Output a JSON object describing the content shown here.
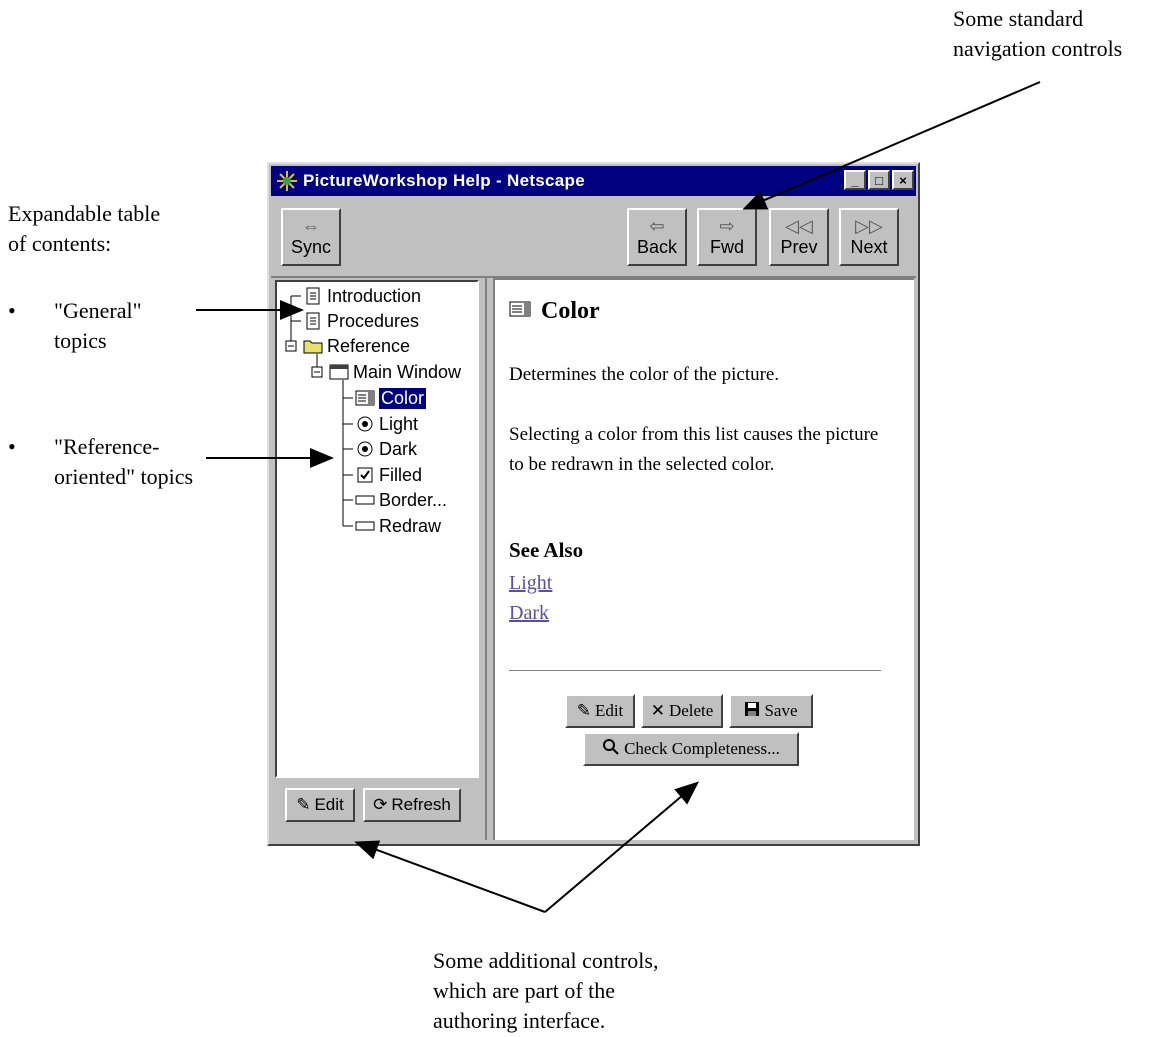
{
  "annotations": {
    "top_right": [
      "Some standard",
      "navigation controls"
    ],
    "left_heading": [
      "Expandable table",
      "of contents:"
    ],
    "general_bullet": [
      "\"General\"",
      "topics"
    ],
    "reference_bullet": [
      "\"Reference-",
      "oriented\" topics"
    ],
    "bullet_symbol": "•",
    "bottom": [
      "Some additional controls,",
      "which are part of the",
      "authoring interface."
    ]
  },
  "window": {
    "title": "PictureWorkshop Help - Netscape",
    "controls": {
      "minimize": "_",
      "maximize": "□",
      "close": "×"
    }
  },
  "toolbar": {
    "sync": {
      "label": "Sync",
      "icon": "sync-arrows-icon"
    },
    "back": {
      "label": "Back",
      "icon": "back-arrow-icon"
    },
    "fwd": {
      "label": "Fwd",
      "icon": "forward-arrow-icon"
    },
    "prev": {
      "label": "Prev",
      "icon": "prev-icon"
    },
    "next": {
      "label": "Next",
      "icon": "next-icon"
    }
  },
  "tree": [
    {
      "label": "Introduction",
      "icon": "page-icon",
      "level": 0
    },
    {
      "label": "Procedures",
      "icon": "page-icon",
      "level": 0
    },
    {
      "label": "Reference",
      "icon": "folder-icon",
      "level": 0,
      "expanded": true
    },
    {
      "label": "Main Window",
      "icon": "window-icon",
      "level": 1,
      "expanded": true
    },
    {
      "label": "Color",
      "icon": "listbox-icon",
      "level": 2,
      "selected": true
    },
    {
      "label": "Light",
      "icon": "radio-icon",
      "level": 2
    },
    {
      "label": "Dark",
      "icon": "radio-icon",
      "level": 2
    },
    {
      "label": "Filled",
      "icon": "checkbox-icon",
      "level": 2
    },
    {
      "label": "Border...",
      "icon": "button-icon",
      "level": 2
    },
    {
      "label": "Redraw",
      "icon": "button-icon",
      "level": 2
    }
  ],
  "left_buttons": {
    "edit": "Edit",
    "refresh": "Refresh"
  },
  "doc": {
    "title": "Color",
    "para1": "Determines the color of the picture.",
    "para2": "Selecting a color from this list causes the picture to be redrawn in the selected color.",
    "see_also": "See Also",
    "links": [
      "Light",
      "Dark"
    ]
  },
  "doc_buttons": {
    "edit": "Edit",
    "delete": "Delete",
    "save": "Save",
    "check": "Check Completeness..."
  },
  "colors": {
    "titlebar": "#000080",
    "face": "#c0c0c0",
    "link": "#5a4fa0"
  }
}
